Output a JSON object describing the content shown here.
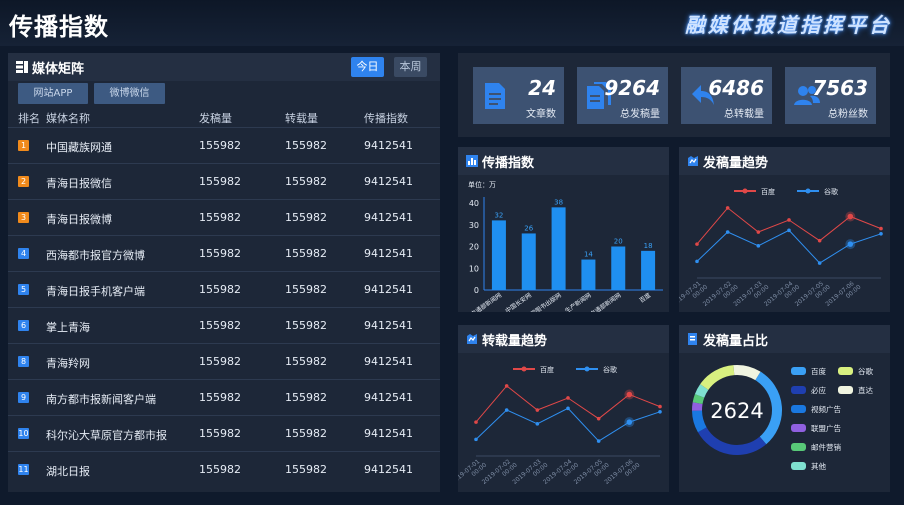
{
  "header": {
    "title": "传播指数",
    "platform": "融媒体报道指挥平台"
  },
  "matrix": {
    "title": "媒体矩阵",
    "tabs": [
      "今日",
      "本周"
    ],
    "subtabs": [
      "网站APP",
      "微博微信"
    ],
    "columns": [
      "排名",
      "媒体名称",
      "发稿量",
      "转载量",
      "传播指数"
    ],
    "rows": [
      {
        "rank": "1",
        "name": "中国藏族网通",
        "posts": "155982",
        "reposts": "155982",
        "index": "9412541"
      },
      {
        "rank": "2",
        "name": "青海日报微信",
        "posts": "155982",
        "reposts": "155982",
        "index": "9412541"
      },
      {
        "rank": "3",
        "name": "青海日报微博",
        "posts": "155982",
        "reposts": "155982",
        "index": "9412541"
      },
      {
        "rank": "4",
        "name": "西海都市报官方微博",
        "posts": "155982",
        "reposts": "155982",
        "index": "9412541"
      },
      {
        "rank": "5",
        "name": "青海日报手机客户端",
        "posts": "155982",
        "reposts": "155982",
        "index": "9412541"
      },
      {
        "rank": "6",
        "name": "掌上青海",
        "posts": "155982",
        "reposts": "155982",
        "index": "9412541"
      },
      {
        "rank": "8",
        "name": "青海羚网",
        "posts": "155982",
        "reposts": "155982",
        "index": "9412541"
      },
      {
        "rank": "9",
        "name": "南方都市报新闻客户端",
        "posts": "155982",
        "reposts": "155982",
        "index": "9412541"
      },
      {
        "rank": "10",
        "name": "科尔沁大草原官方都市报",
        "posts": "155982",
        "reposts": "155982",
        "index": "9412541"
      },
      {
        "rank": "11",
        "name": "湖北日报",
        "posts": "155982",
        "reposts": "155982",
        "index": "9412541"
      }
    ],
    "rank_colors": {
      "top": "#f08a1c",
      "other": "#2f83ee"
    }
  },
  "stats": [
    {
      "value": "24",
      "label": "文章数",
      "icon": "document-icon"
    },
    {
      "value": "9264",
      "label": "总发稿量",
      "icon": "documents-icon"
    },
    {
      "value": "6486",
      "label": "总转载量",
      "icon": "repost-arrow-icon"
    },
    {
      "value": "7563",
      "label": "总粉丝数",
      "icon": "users-icon"
    }
  ],
  "panels": {
    "index_title": "传播指数",
    "posts_trend_title": "发稿量趋势",
    "reposts_trend_title": "转载量趋势",
    "share_title": "发稿量占比"
  },
  "chart_data": [
    {
      "type": "bar",
      "title": "传播指数",
      "unit_label": "单位：万",
      "categories": [
        "交通部新闻网",
        "中国长安网",
        "中国图书出版网",
        "生产新闻网",
        "交通部新闻网",
        "百度"
      ],
      "values": [
        32,
        26,
        38,
        14,
        20,
        18
      ],
      "ylim": [
        0,
        40
      ],
      "yticks": [
        0,
        10,
        20,
        30,
        40
      ],
      "color": "#1f8ff0"
    },
    {
      "type": "line",
      "title": "发稿量趋势",
      "x": [
        "2019-07-01 00:00",
        "2019-07-02 00:00",
        "2019-07-03 00:00",
        "2019-07-04 00:00",
        "2019-07-05 00:00",
        "2019-07-06 00:00"
      ],
      "series": [
        {
          "name": "百度",
          "color": "#e04848",
          "values": [
            30,
            72,
            44,
            58,
            34,
            62,
            48
          ]
        },
        {
          "name": "谷歌",
          "color": "#2f8ff0",
          "values": [
            10,
            44,
            28,
            46,
            8,
            30,
            42
          ]
        }
      ]
    },
    {
      "type": "line",
      "title": "转载量趋势",
      "x": [
        "2019-07-01 00:00",
        "2019-07-02 00:00",
        "2019-07-03 00:00",
        "2019-07-04 00:00",
        "2019-07-05 00:00",
        "2019-07-06 00:00"
      ],
      "series": [
        {
          "name": "百度",
          "color": "#e04848",
          "values": [
            30,
            72,
            44,
            58,
            34,
            62,
            48
          ]
        },
        {
          "name": "谷歌",
          "color": "#2f8ff0",
          "values": [
            10,
            44,
            28,
            46,
            8,
            30,
            42
          ]
        }
      ]
    },
    {
      "type": "pie",
      "title": "发稿量占比",
      "total_label": "2624",
      "slices": [
        {
          "name": "百度",
          "value": 30,
          "color": "#3aa0f5"
        },
        {
          "name": "必应",
          "value": 28,
          "color": "#1f3fb0"
        },
        {
          "name": "视频广告",
          "value": 8,
          "color": "#1a78e0"
        },
        {
          "name": "联盟广告",
          "value": 3,
          "color": "#9060e0"
        },
        {
          "name": "邮件营销",
          "value": 3,
          "color": "#58c878"
        },
        {
          "name": "其他",
          "value": 4,
          "color": "#7fe0d0"
        },
        {
          "name": "谷歌",
          "value": 14,
          "color": "#d8f080"
        },
        {
          "name": "直达",
          "value": 10,
          "color": "#f0f4e0"
        }
      ],
      "legend_order": [
        [
          "百度",
          "谷歌"
        ],
        [
          "必应",
          "直达"
        ],
        [
          "视频广告"
        ],
        [
          "联盟广告"
        ],
        [
          "邮件营销"
        ],
        [
          "其他"
        ]
      ]
    }
  ]
}
